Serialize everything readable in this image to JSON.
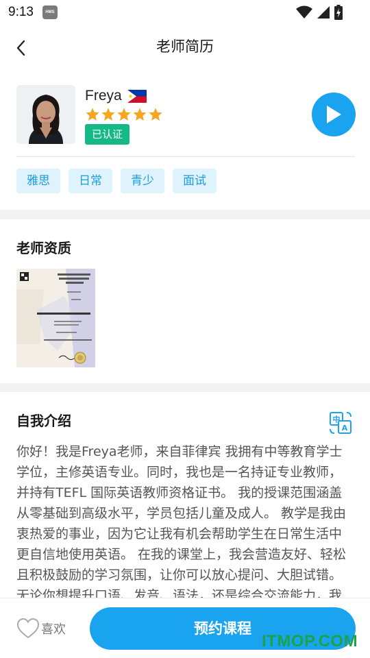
{
  "status_bar": {
    "time": "9:13",
    "hms_badge": "HMS"
  },
  "nav": {
    "title": "老师简历",
    "back_icon": "chevron-left-icon"
  },
  "profile": {
    "name": "Freya",
    "flag": "philippines-flag",
    "rating": 5,
    "verified_label": "已认证",
    "tags": [
      "雅思",
      "日常",
      "青少",
      "面试"
    ],
    "play_icon": "play-icon",
    "colors": {
      "accent": "#1aa3ef",
      "verified": "#14b985",
      "star": "#f5a623",
      "tag_bg": "#dff3fd"
    }
  },
  "qualifications": {
    "title": "老师资质"
  },
  "intro": {
    "title": "自我介绍",
    "translate_icon": "translate-icon",
    "text": "你好！我是Freya老师，来自菲律宾 我拥有中等教育学士学位，主修英语专业。同时，我也是一名持证专业教师，并持有TEFL 国际英语教师资格证书。 我的授课范围涵盖从零基础到高级水平，学员包括儿童及成人。 教学是我由衷热爱的事业，因为它让我有机会帮助学生在日常生活中更自信地使用英语。 在我的课堂上，我会营造友好、轻松且积极鼓励的学习氛围，让你可以放心提问、大胆试错。无论你想提升口语、发音、语法，还是综合交流能力，我都很乐意全程为你指导。 非常期待与"
  },
  "bottom": {
    "like_label": "喜欢",
    "book_label": "预约课程"
  },
  "watermark": "ITMOP.COM"
}
